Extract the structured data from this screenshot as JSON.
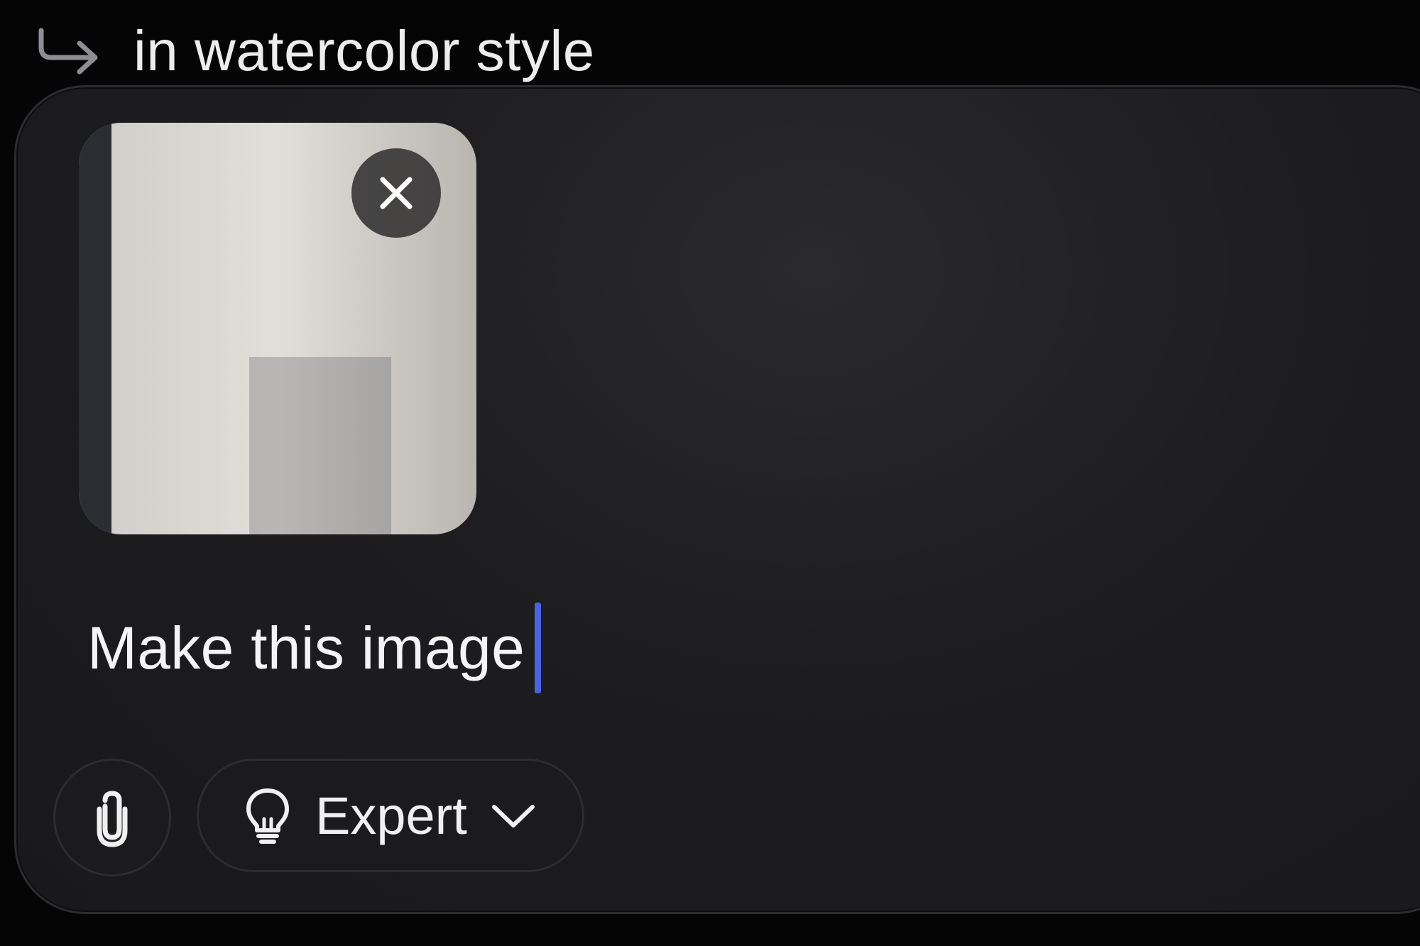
{
  "reply": {
    "icon": "reply-arrow-icon",
    "text": "in watercolor style"
  },
  "attachment": {
    "thumbnail_alt": "attached photo",
    "remove_icon": "close-icon"
  },
  "composer": {
    "prompt_text": "Make this image"
  },
  "toolbar": {
    "attach_icon": "paperclip-icon",
    "mode_icon": "lightbulb-icon",
    "mode_label": "Expert",
    "mode_chevron_icon": "chevron-down-icon"
  },
  "colors": {
    "background": "#050506",
    "panel": "#1d1d20",
    "caret": "#4a63e0",
    "text": "#f2f2f2"
  }
}
